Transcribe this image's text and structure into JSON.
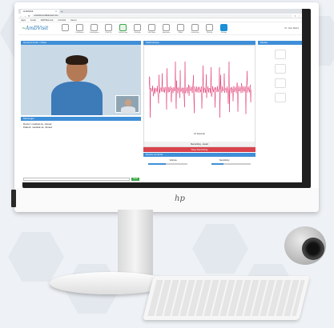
{
  "browser": {
    "tab_title": "AmDVisit",
    "url": "amdvisit.amdtelemed.com",
    "bookmarks": [
      "Apps",
      "Gmail",
      "AMDTelemed",
      "Amdvisit",
      "Server"
    ]
  },
  "app": {
    "brand": "AmDVisit",
    "tools": [
      {
        "label": "",
        "state": "normal"
      },
      {
        "label": "Dashboard",
        "state": "normal"
      },
      {
        "label": "Thermometer",
        "state": "normal"
      },
      {
        "label": "Pulse Ox",
        "state": "normal"
      },
      {
        "label": "Stethoscope",
        "state": "active"
      },
      {
        "label": "Otoscope",
        "state": "normal"
      },
      {
        "label": "Vital Signs",
        "state": "normal"
      },
      {
        "label": "Spirometer",
        "state": "normal"
      },
      {
        "label": "Notes",
        "state": "normal"
      },
      {
        "label": "Documents",
        "state": "normal"
      },
      {
        "label": "Sharing",
        "state": "normal"
      },
      {
        "label": "Settings",
        "state": "selected"
      }
    ],
    "user": "Dr. John Marks"
  },
  "video_panel": {
    "title": "General Audio / Video"
  },
  "messages_panel": {
    "title": "Messages",
    "lines": [
      "Doctor: medical ok, Joined",
      "Patient: medical ok, Joined"
    ],
    "send_label": "Send"
  },
  "waveform_panel": {
    "title": "Stethoscope",
    "time_label": "10 Seconds",
    "status_label": "Recording - Heart",
    "stop_label": "Stop Recording",
    "trace_color": "#e0306a"
  },
  "device_controls": {
    "title": "Device Controls",
    "volume_label": "Volume",
    "sensitivity_label": "Sensitivity",
    "volume_level": 0.45,
    "sensitivity_level": 0.3
  },
  "modality_panel": {
    "title": "Modes"
  },
  "monitor": {
    "logo": "hp"
  }
}
